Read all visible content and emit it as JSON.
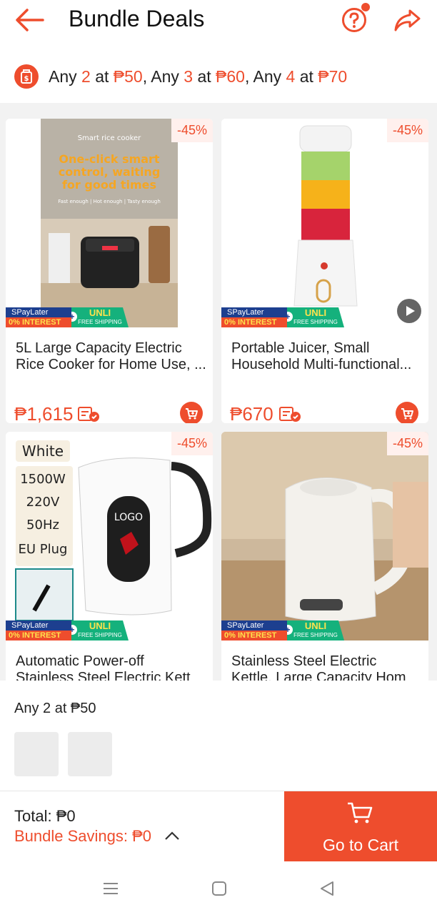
{
  "header": {
    "title": "Bundle Deals",
    "back_icon": "back-arrow-icon",
    "help_icon": "help-question-icon",
    "share_icon": "share-icon"
  },
  "promo": {
    "icon": "bundle-tag-icon",
    "parts": {
      "p1": "Any ",
      "q1": "2",
      "p2": " at ",
      "v1": "₱50",
      "p3": ", Any ",
      "q2": "3",
      "p4": " at ",
      "v2": "₱60",
      "p5": ", Any ",
      "q3": "4",
      "p6": " at ",
      "v3": "₱70"
    }
  },
  "badges": {
    "spaylater": "SPayLater",
    "interest": "0% INTEREST",
    "unli": "UNLI",
    "free_shipping": "FREE SHIPPING"
  },
  "products": [
    {
      "discount": "-45%",
      "name_line1": "5L Large Capacity Electric",
      "name_line2": "Rice Cooker for Home Use, ...",
      "price": "₱1,615",
      "img_title": "Smart rice cooker",
      "img_headline1": "One-click smart",
      "img_headline2": "control, waiting",
      "img_headline3": "for good times",
      "img_sub": "Fast enough | Hot enough | Tasty enough"
    },
    {
      "discount": "-45%",
      "name_line1": "Portable Juicer, Small",
      "name_line2": "Household Multi-functional...",
      "price": "₱670"
    },
    {
      "discount": "-45%",
      "name_line1": "Automatic Power-off",
      "name_line2": "Stainless Steel Electric Kett",
      "specs": [
        "White",
        "1500W",
        "220V",
        "50Hz",
        "EU Plug"
      ],
      "logo": "LOGO"
    },
    {
      "discount": "-45%",
      "name_line1": "Stainless Steel Electric",
      "name_line2": "Kettle, Large Capacity Hom"
    }
  ],
  "bundle": {
    "title": "Any 2 at ₱50"
  },
  "footer": {
    "total": "Total: ₱0",
    "savings": "Bundle Savings: ₱0",
    "go_to_cart": "Go to Cart"
  },
  "colors": {
    "accent": "#ee4d2d",
    "spay_blue": "#1d3f8f",
    "unli_green": "#15b17c"
  }
}
